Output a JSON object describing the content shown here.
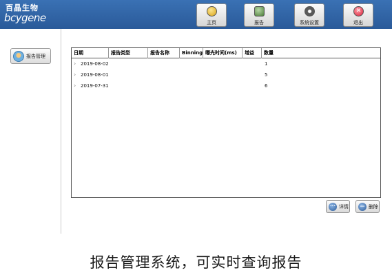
{
  "brand": {
    "logo_cn": "百晶生物",
    "logo_en": "bcygene"
  },
  "nav": [
    {
      "label": "主页",
      "icon": "home-icon"
    },
    {
      "label": "报告",
      "icon": "report-icon"
    },
    {
      "label": "系统设置",
      "icon": "settings-icon"
    },
    {
      "label": "退出",
      "icon": "exit-icon",
      "glyph": "✕"
    }
  ],
  "sidebar": {
    "items": [
      {
        "label": "报告管理",
        "icon": "report-management-icon"
      }
    ]
  },
  "table": {
    "columns": [
      "日期",
      "报告类型",
      "报告名称",
      "Binning",
      "曝光时间(ms)",
      "增益",
      "数量"
    ],
    "expander_glyph": "›",
    "rows": [
      {
        "date": "2019-08-02",
        "count": "1"
      },
      {
        "date": "2019-08-01",
        "count": "5"
      },
      {
        "date": "2019-07-31",
        "count": "6"
      }
    ]
  },
  "actions": {
    "detail": {
      "label": "详情",
      "glyph": "···"
    },
    "delete": {
      "label": "删除",
      "glyph": "—"
    }
  },
  "caption": "报告管理系统，可实时查询报告",
  "colors": {
    "topbar": "#2f63a6",
    "border": "#555555"
  }
}
